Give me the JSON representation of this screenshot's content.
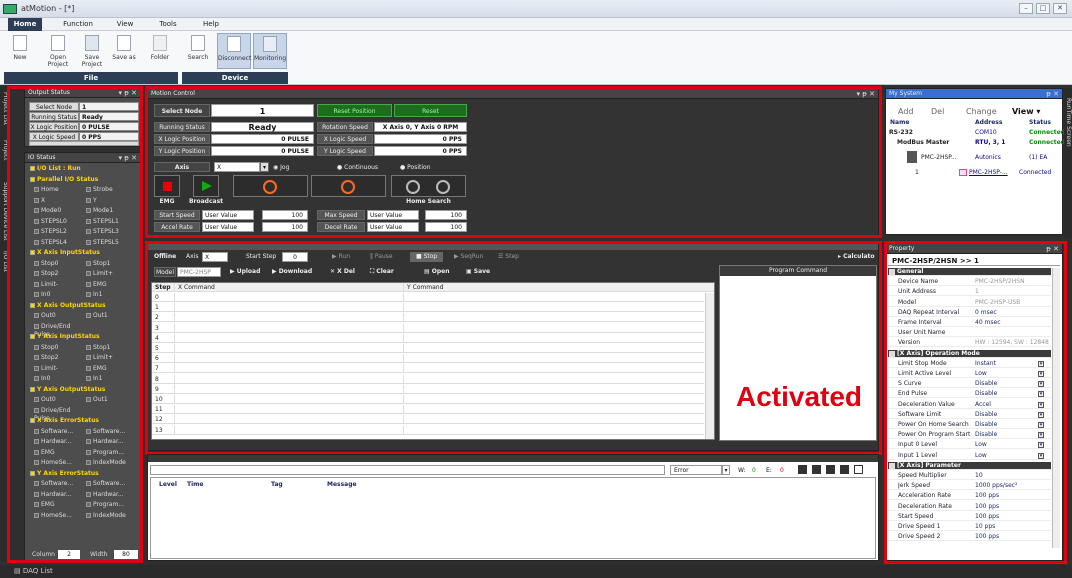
{
  "app": {
    "title": "atMotion - [*]"
  },
  "window_controls": [
    "–",
    "□",
    "✕"
  ],
  "menu": [
    "Home",
    "Function",
    "View",
    "Tools",
    "Help"
  ],
  "ribbon": {
    "file_buttons": [
      "New",
      "Open Project",
      "Save Project",
      "Save as",
      "Folder"
    ],
    "file_group": "File",
    "device_buttons": [
      "Search",
      "Disconnect",
      "Monitoring"
    ],
    "device_group": "Device"
  },
  "side_tabs": [
    "Project List",
    "Project",
    "Support Device List",
    "I/O List"
  ],
  "right_side_tab": "RunTime Screen",
  "output_status": {
    "title": "Output Status",
    "rows": [
      {
        "k": "Select Node",
        "v": "1"
      },
      {
        "k": "Running Status",
        "v": "Ready"
      },
      {
        "k": "X Logic Position",
        "v": "0 PULSE"
      },
      {
        "k": "X Logic Speed",
        "v": "0 PPS"
      }
    ]
  },
  "io_status": {
    "title": "IO Status",
    "items": [
      {
        "t": "I/O List : Run",
        "h": 1
      },
      {
        "t": "Parallel I/O Status",
        "h": 1
      },
      {
        "t": "Home",
        "t2": "Strobe"
      },
      {
        "t": "X",
        "t2": "Y"
      },
      {
        "t": "Mode0",
        "t2": "Mode1"
      },
      {
        "t": "STEPSL0",
        "t2": "STEPSL1"
      },
      {
        "t": "STEPSL2",
        "t2": "STEPSL3"
      },
      {
        "t": "STEPSL4",
        "t2": "STEPSL5"
      },
      {
        "t": "X Axis InputStatus",
        "h": 1
      },
      {
        "t": "Stop0",
        "t2": "Stop1"
      },
      {
        "t": "Stop2",
        "t2": "Limit+"
      },
      {
        "t": "Limit-",
        "t2": "EMG"
      },
      {
        "t": "In0",
        "t2": "In1"
      },
      {
        "t": "X Axis OutputStatus",
        "h": 1
      },
      {
        "t": "Out0",
        "t2": "Out1"
      },
      {
        "t": "Drive/End Pulse"
      },
      {
        "t": "Y Axis InputStatus",
        "h": 1
      },
      {
        "t": "Stop0",
        "t2": "Stop1"
      },
      {
        "t": "Stop2",
        "t2": "Limit+"
      },
      {
        "t": "Limit-",
        "t2": "EMG"
      },
      {
        "t": "In0",
        "t2": "In1"
      },
      {
        "t": "Y Axis OutputStatus",
        "h": 1
      },
      {
        "t": "Out0",
        "t2": "Out1"
      },
      {
        "t": "Drive/End Pulse"
      },
      {
        "t": "X Axis ErrorStatus",
        "h": 1
      },
      {
        "t": "Software...",
        "t2": "Software..."
      },
      {
        "t": "Hardwar...",
        "t2": "Hardwar..."
      },
      {
        "t": "EMG",
        "t2": "Program..."
      },
      {
        "t": "HomeSe...",
        "t2": "IndexMode"
      },
      {
        "t": "Y Axis ErrorStatus",
        "h": 1
      },
      {
        "t": "Software...",
        "t2": "Software..."
      },
      {
        "t": "Hardwar...",
        "t2": "Hardwar..."
      },
      {
        "t": "EMG",
        "t2": "Program..."
      },
      {
        "t": "HomeSe...",
        "t2": "IndexMode"
      }
    ],
    "column_label": "Column",
    "column_value": "2",
    "width_label": "Width",
    "width_value": "80"
  },
  "motion_control": {
    "title": "Motion Control",
    "select_node_label": "Select Node",
    "select_node_value": "1",
    "reset_position": "Reset Position",
    "reset": "Reset",
    "running_status_label": "Running Status",
    "running_status_value": "Ready",
    "rotation_speed_label": "Rotation Speed",
    "rotation_speed_value": "X Axis 0, Y Axis 0 RPM",
    "x_logic_pos_label": "X Logic Position",
    "x_logic_pos_value": "0 PULSE",
    "x_logic_speed_label": "X Logic Speed",
    "x_logic_speed_value": "0 PPS",
    "y_logic_pos_label": "Y Logic Position",
    "y_logic_pos_value": "0 PULSE",
    "y_logic_speed_label": "Y Logic Speed",
    "y_logic_speed_value": "0 PPS",
    "axis_label": "Axis",
    "axis_value": "X",
    "mode_jog": "Jog",
    "mode_continuous": "Continuous",
    "mode_position": "Position",
    "emg": "EMG",
    "broadcast": "Broadcast",
    "home_search": "Home Search",
    "start_speed_label": "Start Speed",
    "start_speed_type": "User Value",
    "start_speed_value": "100",
    "max_speed_label": "Max Speed",
    "max_speed_type": "User Value",
    "max_speed_value": "100",
    "accel_label": "Accel Rate",
    "accel_type": "User Value",
    "accel_value": "100",
    "decel_label": "Decel Rate",
    "decel_type": "User Value",
    "decel_value": "100"
  },
  "program": {
    "offline": "Offline",
    "axis_label": "Axis",
    "axis_value": "X",
    "start_step_label": "Start Step",
    "start_step_value": "0",
    "run": "Run",
    "pause": "Pause",
    "stop": "Stop",
    "seqrun": "SeqRun",
    "step": "Step",
    "calculator": "Calculato",
    "model_label": "Model",
    "model_value": "PMC-2HSP",
    "upload": "Upload",
    "download": "Download",
    "xdel": "X Del",
    "clear": "Clear",
    "open": "Open",
    "save": "Save",
    "col_step": "Step",
    "col_x": "X Command",
    "col_y": "Y Command",
    "steps": [
      "0",
      "1",
      "2",
      "3",
      "4",
      "5",
      "6",
      "7",
      "8",
      "9",
      "10",
      "11",
      "12",
      "13"
    ],
    "program_command": "Program Command",
    "activated": "Activated"
  },
  "message": {
    "filter_value": "Error",
    "w_label": "W:",
    "w_value": "0",
    "e_label": "E:",
    "e_value": "0",
    "cols": [
      "Level",
      "Time",
      "Tag",
      "Message"
    ]
  },
  "my_system": {
    "title": "My System",
    "add": "Add",
    "del": "Del",
    "change": "Change",
    "view": "View",
    "cols": [
      "Name",
      "Address",
      "Status"
    ],
    "rows": [
      {
        "name": "RS-232",
        "addr": "COM10",
        "status": "Connected"
      },
      {
        "name": "ModBus Master",
        "addr": "RTU, 3, 1",
        "status": "Connected"
      },
      {
        "name": "PMC-2HSP...",
        "addr": "Autonics",
        "status": "(1) EA"
      },
      {
        "name": "1",
        "addr": "PMC-2HSP-...",
        "status": "Connected"
      }
    ]
  },
  "property": {
    "title": "Property",
    "header": "PMC-2HSP/2HSN >> 1",
    "rows": [
      {
        "sec": "General"
      },
      {
        "k": "Device Name",
        "v": "PMC-2HSP/2HSN",
        "g": 1
      },
      {
        "k": "Unit Address",
        "v": "1",
        "g": 1
      },
      {
        "k": "Model",
        "v": "PMC-2HSP-USB",
        "g": 1
      },
      {
        "k": "DAQ Repeat Interval",
        "v": "0 msec"
      },
      {
        "k": "Frame Interval",
        "v": "40 msec"
      },
      {
        "k": "User Unit Name",
        "v": ""
      },
      {
        "k": "Version",
        "v": "HW : 12594, SW : 12848",
        "g": 1
      },
      {
        "sec": "[X Axis] Operation Mode"
      },
      {
        "k": "Limit Stop Mode",
        "v": "Instant",
        "dd": 1
      },
      {
        "k": "Limit Active Level",
        "v": "Low",
        "dd": 1
      },
      {
        "k": "S Curve",
        "v": "Disable",
        "dd": 1
      },
      {
        "k": "End Pulse",
        "v": "Disable",
        "dd": 1
      },
      {
        "k": "Deceleration Value",
        "v": "Accel",
        "dd": 1
      },
      {
        "k": "Software Limit",
        "v": "Disable",
        "dd": 1
      },
      {
        "k": "Power On Home Search",
        "v": "Disable",
        "dd": 1
      },
      {
        "k": "Power On Program Start",
        "v": "Disable",
        "dd": 1
      },
      {
        "k": "Input 0 Level",
        "v": "Low",
        "dd": 1
      },
      {
        "k": "Input 1 Level",
        "v": "Low",
        "dd": 1
      },
      {
        "sec": "[X Axis] Parameter"
      },
      {
        "k": "Speed Multiplier",
        "v": "10"
      },
      {
        "k": "Jerk Speed",
        "v": "1000 pps/sec²"
      },
      {
        "k": "Acceleration Rate",
        "v": "100 pps"
      },
      {
        "k": "Deceleration Rate",
        "v": "100 pps"
      },
      {
        "k": "Start Speed",
        "v": "100 pps"
      },
      {
        "k": "Drive Speed 1",
        "v": "10 pps"
      },
      {
        "k": "Drive Speed 2",
        "v": "100 pps"
      }
    ]
  },
  "statusbar": {
    "daq_list": "DAQ List"
  },
  "colors": {
    "accent": "#2d3d55",
    "highlight_red": "#e00010",
    "status_green": "#0a8a0a",
    "io_header_yellow": "#ffd600"
  }
}
